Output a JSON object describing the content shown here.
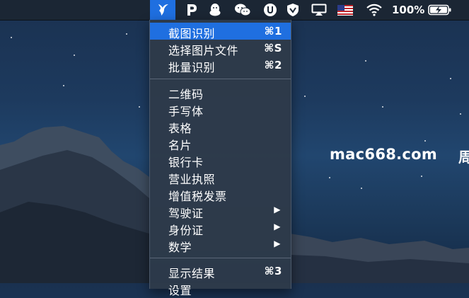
{
  "menubar": {
    "battery_percent": "100%",
    "icons": [
      "app-bird-icon",
      "p-icon",
      "qq-penguin-icon",
      "wechat-icon",
      "u-shield-icon",
      "v-shield-icon",
      "airplay-icon",
      "us-flag-icon",
      "wifi-icon",
      "battery-charging-icon"
    ]
  },
  "menu": {
    "items": [
      {
        "label": "截图识别",
        "shortcut": "⌘1"
      },
      {
        "label": "选择图片文件",
        "shortcut": "⌘S"
      },
      {
        "label": "批量识别",
        "shortcut": "⌘2"
      },
      {
        "label": "二维码"
      },
      {
        "label": "手写体"
      },
      {
        "label": "表格"
      },
      {
        "label": "名片"
      },
      {
        "label": "银行卡"
      },
      {
        "label": "营业执照"
      },
      {
        "label": "增值税发票"
      },
      {
        "label": "驾驶证"
      },
      {
        "label": "身份证"
      },
      {
        "label": "数学"
      },
      {
        "label": "显示结果",
        "shortcut": "⌘3"
      }
    ],
    "submenu_arrow": "▶",
    "partial_last_label": "设置"
  },
  "watermark": "mac668.com",
  "edge_char": "周",
  "colors": {
    "highlight": "#1f6fe0",
    "menu_bg": "#2e3a4a",
    "menubar_bg": "#1b2634"
  }
}
